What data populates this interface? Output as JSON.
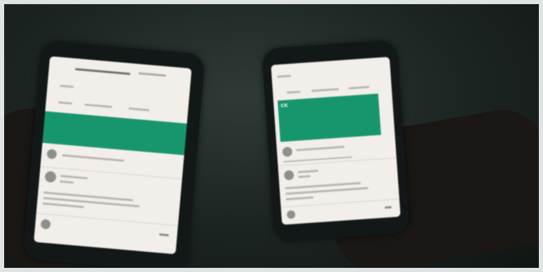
{
  "photo": {
    "description_icons": [
      "left-phone",
      "right-phone"
    ],
    "colors": {
      "banner": "#17966e",
      "screen": "#f2eeea",
      "phone_body": "#121818",
      "background": "#1c2421"
    }
  },
  "right_phone": {
    "banner_text": "CK"
  }
}
